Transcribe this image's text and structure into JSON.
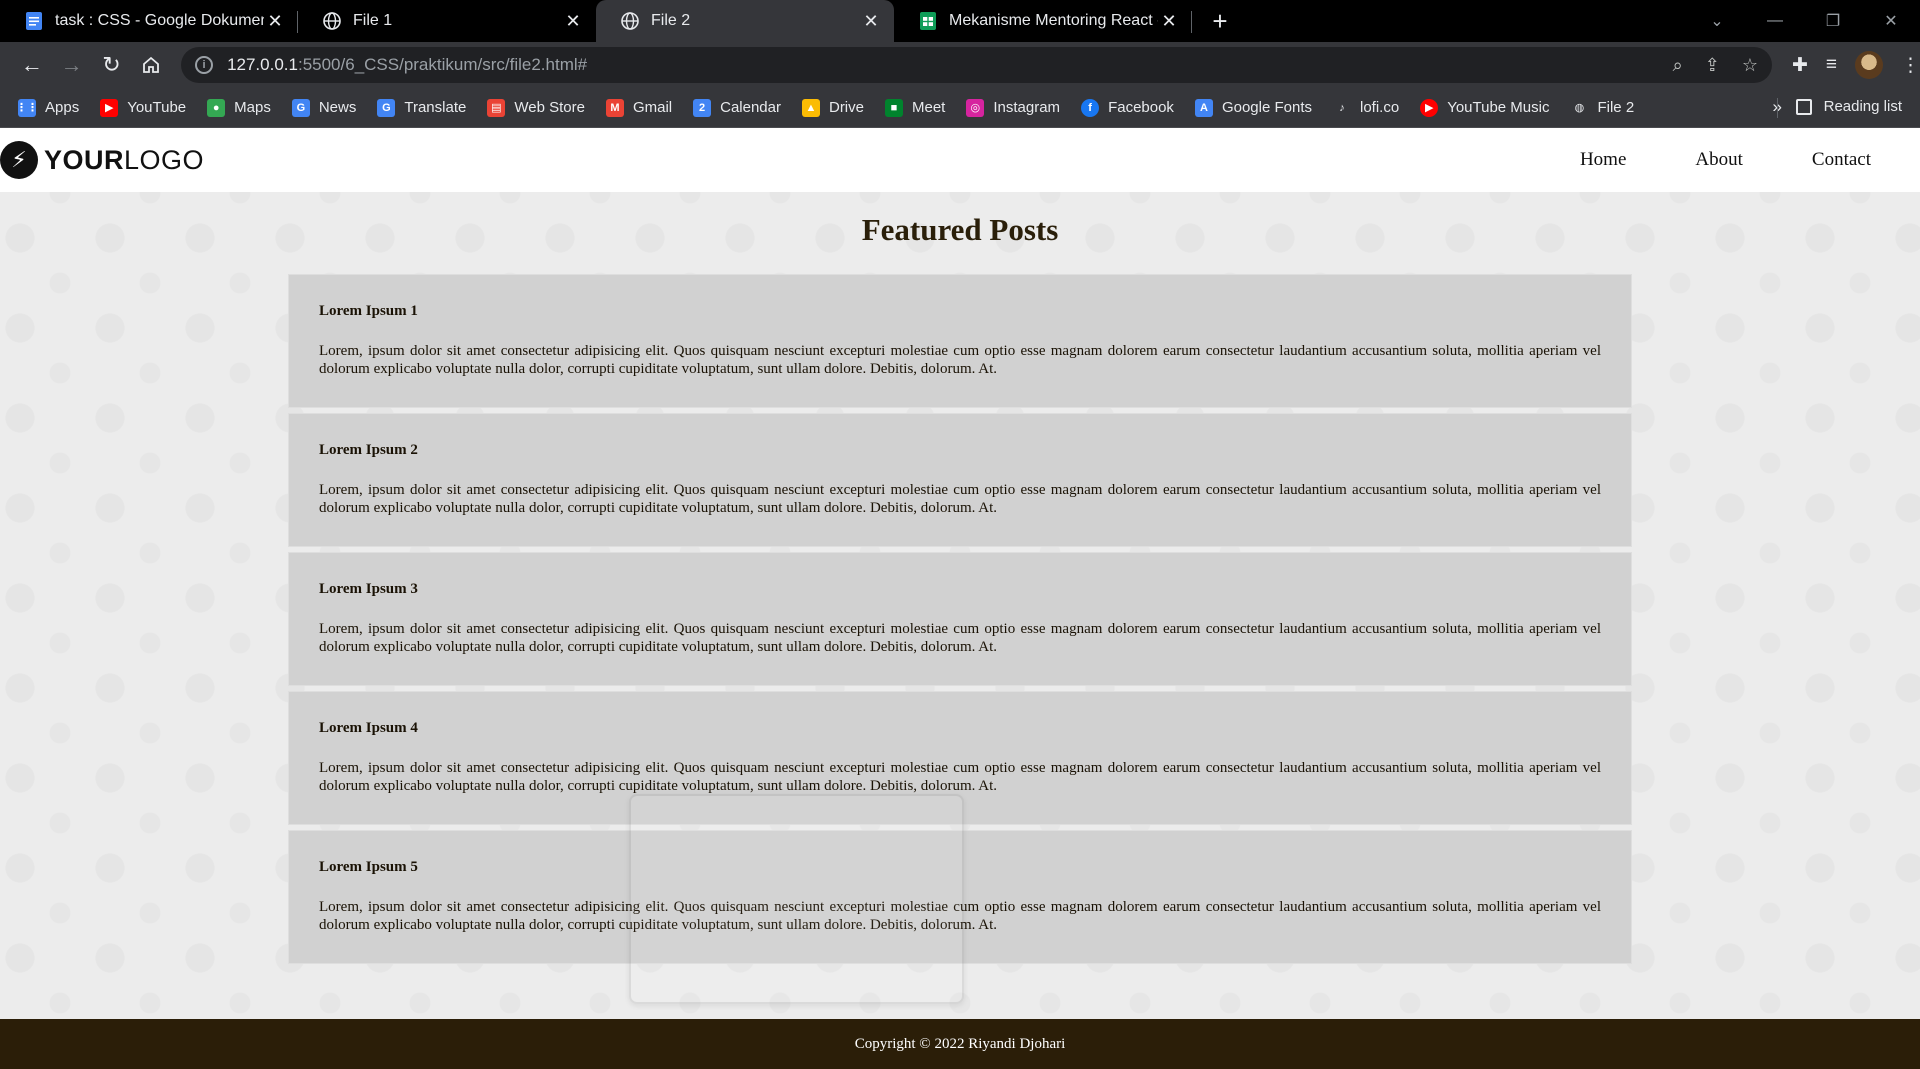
{
  "browser": {
    "tabs": [
      {
        "title": "task : CSS - Google Dokumen",
        "icon": "docs-icon",
        "active": false
      },
      {
        "title": "File 1",
        "icon": "globe-icon",
        "active": false
      },
      {
        "title": "File 2",
        "icon": "globe-icon",
        "active": true
      },
      {
        "title": "Mekanisme Mentoring React - Go",
        "icon": "sheets-icon",
        "active": false
      }
    ],
    "address": {
      "host": "127.0.0.1",
      "rest": ":5500/6_CSS/praktikum/src/file2.html#"
    },
    "bookmarks": [
      {
        "label": "Apps",
        "icon": "apps-grid-icon",
        "color": "#4285f4"
      },
      {
        "label": "YouTube",
        "icon": "youtube-icon",
        "color": "#ff0000"
      },
      {
        "label": "Maps",
        "icon": "maps-pin-icon",
        "color": "#34a853"
      },
      {
        "label": "News",
        "icon": "news-icon",
        "color": "#4285f4"
      },
      {
        "label": "Translate",
        "icon": "translate-icon",
        "color": "#4285f4"
      },
      {
        "label": "Web Store",
        "icon": "web-store-icon",
        "color": "#ea4335"
      },
      {
        "label": "Gmail",
        "icon": "gmail-icon",
        "color": "#ea4335"
      },
      {
        "label": "Calendar",
        "icon": "calendar-icon",
        "color": "#4285f4"
      },
      {
        "label": "Drive",
        "icon": "drive-icon",
        "color": "#fbbc04"
      },
      {
        "label": "Meet",
        "icon": "meet-icon",
        "color": "#00832d"
      },
      {
        "label": "Instagram",
        "icon": "instagram-icon",
        "color": "#d6249f"
      },
      {
        "label": "Facebook",
        "icon": "facebook-icon",
        "color": "#1877f2"
      },
      {
        "label": "Google Fonts",
        "icon": "google-fonts-icon",
        "color": "#4285f4"
      },
      {
        "label": "lofi.co",
        "icon": "lofi-icon",
        "color": "#e8eaed"
      },
      {
        "label": "YouTube Music",
        "icon": "youtube-music-icon",
        "color": "#ff0000"
      },
      {
        "label": "File 2",
        "icon": "globe-icon",
        "color": "#e8eaed"
      }
    ],
    "more_bookmarks": "»",
    "reading_list": "Reading list"
  },
  "site": {
    "logo": {
      "bold": "YOUR",
      "light": "LOGO"
    },
    "nav": [
      "Home",
      "About",
      "Contact"
    ],
    "heading": "Featured Posts",
    "posts": [
      {
        "title": "Lorem Ipsum 1",
        "body": "Lorem, ipsum dolor sit amet consectetur adipisicing elit. Quos quisquam nesciunt excepturi molestiae cum optio esse magnam dolorem earum consectetur laudantium accusantium soluta, mollitia aperiam vel dolorum explicabo voluptate nulla dolor, corrupti cupiditate voluptatum, sunt ullam dolore. Debitis, dolorum. At."
      },
      {
        "title": "Lorem Ipsum 2",
        "body": "Lorem, ipsum dolor sit amet consectetur adipisicing elit. Quos quisquam nesciunt excepturi molestiae cum optio esse magnam dolorem earum consectetur laudantium accusantium soluta, mollitia aperiam vel dolorum explicabo voluptate nulla dolor, corrupti cupiditate voluptatum, sunt ullam dolore. Debitis, dolorum. At."
      },
      {
        "title": "Lorem Ipsum 3",
        "body": "Lorem, ipsum dolor sit amet consectetur adipisicing elit. Quos quisquam nesciunt excepturi molestiae cum optio esse magnam dolorem earum consectetur laudantium accusantium soluta, mollitia aperiam vel dolorum explicabo voluptate nulla dolor, corrupti cupiditate voluptatum, sunt ullam dolore. Debitis, dolorum. At."
      },
      {
        "title": "Lorem Ipsum 4",
        "body": "Lorem, ipsum dolor sit amet consectetur adipisicing elit. Quos quisquam nesciunt excepturi molestiae cum optio esse magnam dolorem earum consectetur laudantium accusantium soluta, mollitia aperiam vel dolorum explicabo voluptate nulla dolor, corrupti cupiditate voluptatum, sunt ullam dolore. Debitis, dolorum. At."
      },
      {
        "title": "Lorem Ipsum 5",
        "body": "Lorem, ipsum dolor sit amet consectetur adipisicing elit. Quos quisquam nesciunt excepturi molestiae cum optio esse magnam dolorem earum consectetur laudantium accusantium soluta, mollitia aperiam vel dolorum explicabo voluptate nulla dolor, corrupti cupiditate voluptatum, sunt ullam dolore. Debitis, dolorum. At."
      }
    ],
    "footer": "Copyright © 2022 Riyandi Djohari"
  },
  "colors": {
    "footer_bg": "#2b1e08",
    "post_bg": "#d1d1d1",
    "page_bg": "#ececec"
  }
}
